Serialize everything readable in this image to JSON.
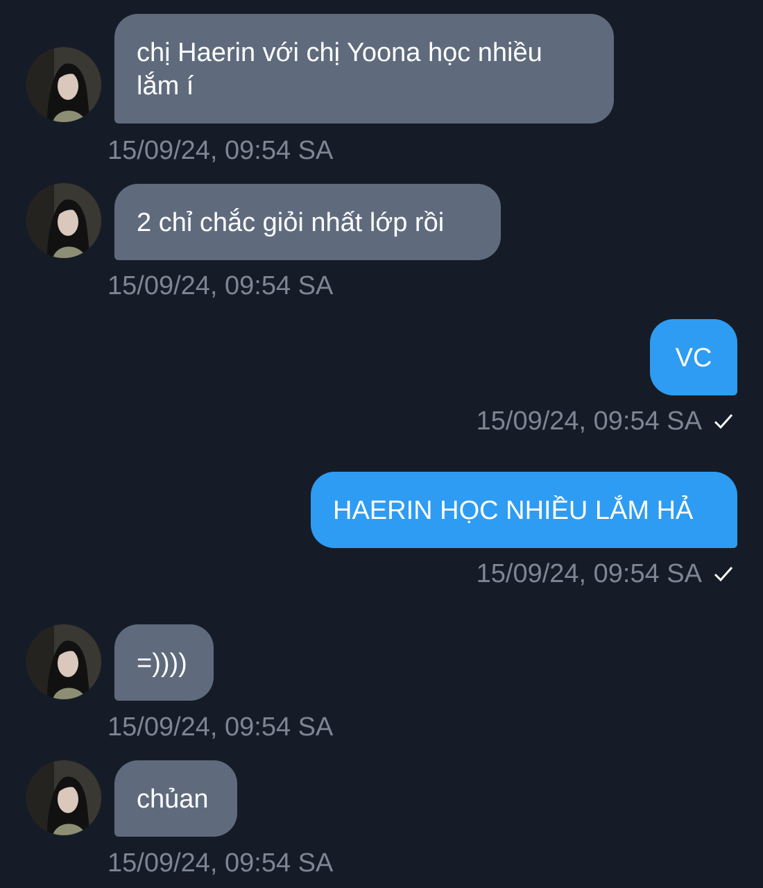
{
  "messages": [
    {
      "direction": "incoming",
      "text": "chị Haerin với chị Yoona học nhiều lắm í",
      "timestamp": "15/09/24, 09:54 SA"
    },
    {
      "direction": "incoming",
      "text": "2 chỉ chắc giỏi nhất lớp rồi",
      "timestamp": "15/09/24, 09:54 SA"
    },
    {
      "direction": "outgoing",
      "text": "VC",
      "timestamp": "15/09/24, 09:54 SA",
      "status_icon": "check-icon"
    },
    {
      "direction": "outgoing",
      "text": "HAERIN HỌC NHIỀU LẮM HẢ",
      "timestamp": "15/09/24, 09:54 SA",
      "status_icon": "check-icon"
    },
    {
      "direction": "incoming",
      "text": "=))))",
      "timestamp": "15/09/24, 09:54 SA"
    },
    {
      "direction": "incoming",
      "text": "chủan",
      "timestamp": "15/09/24, 09:54 SA"
    }
  ],
  "colors": {
    "background": "#161c27",
    "incoming_bubble": "#5f6b7d",
    "outgoing_bubble": "#2e9cf2",
    "timestamp": "#7d8695",
    "text": "#ffffff"
  }
}
